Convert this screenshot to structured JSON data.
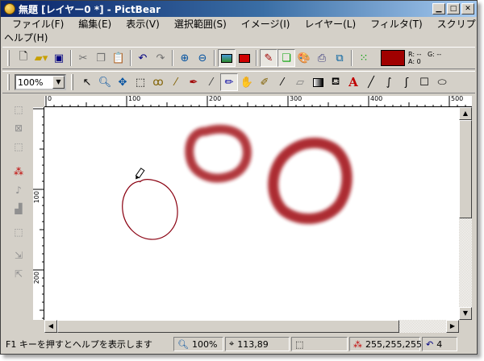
{
  "window": {
    "title": "無題 [レイヤー0 *] - PictBear",
    "buttons": {
      "minimize": "▁",
      "maximize": "□",
      "close": "✕"
    }
  },
  "menu": {
    "row1": [
      "ファイル(F)",
      "編集(E)",
      "表示(V)",
      "選択範囲(S)",
      "イメージ(I)",
      "レイヤー(L)",
      "フィルタ(T)",
      "スクリプト(C)"
    ],
    "row2": [
      "ヘルプ(H)"
    ]
  },
  "toolbar1": {
    "icons": [
      "new-file",
      "open-folder",
      "save",
      "cut",
      "copy",
      "paste",
      "undo",
      "redo",
      "zoom-in",
      "zoom-out",
      "image-view",
      "red-rect",
      "brush-settings",
      "layers",
      "palette",
      "printer",
      "preview",
      "grid-dots"
    ],
    "current_color": "#a00000",
    "rgb_r": "R: --",
    "rgb_g": "G: --",
    "rgb_a": "A: 0"
  },
  "toolbar2": {
    "zoom_value": "100%",
    "tools": [
      "arrow",
      "zoom",
      "move",
      "rect-select",
      "lasso",
      "wand",
      "pen",
      "brush",
      "pencil",
      "hand",
      "airbrush",
      "dropper",
      "eraser",
      "gradient",
      "fill",
      "text",
      "line",
      "curve",
      "bezier",
      "rectangle",
      "ellipse"
    ],
    "text_tool_glyph": "A"
  },
  "ruler": {
    "top_labels": [
      "0",
      "100",
      "200",
      "300",
      "400",
      "500"
    ],
    "left_labels": [
      "100",
      "200"
    ]
  },
  "status": {
    "help": "F1 キーを押すとヘルプを表示します",
    "zoom": "100%",
    "coords": "113,89",
    "color": "255,255,255",
    "history": "4"
  }
}
